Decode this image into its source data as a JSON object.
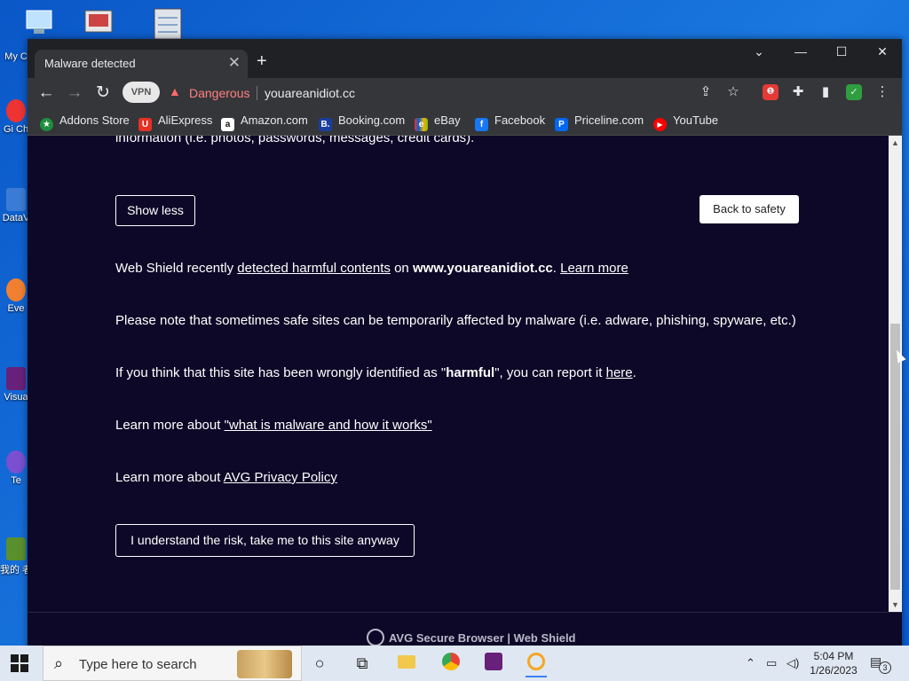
{
  "desktop": {
    "icons": [
      {
        "label": "My C"
      },
      {
        "label": "Gi Ch"
      },
      {
        "label": "DataV"
      },
      {
        "label": "Eve"
      },
      {
        "label": "Visua"
      },
      {
        "label": "Te"
      },
      {
        "label": "我的 者"
      }
    ]
  },
  "browser": {
    "tab_title": "Malware detected",
    "tab_close": "✕",
    "new_tab": "+",
    "window_controls": {
      "dropdown": "⌄",
      "minimize": "—",
      "maximize": "☐",
      "close": "✕"
    }
  },
  "toolbar": {
    "back": "←",
    "forward": "→",
    "reload": "↻",
    "vpn_label": "VPN",
    "security_label": "Dangerous",
    "url": "youareanidiot.cc"
  },
  "bookmarks": [
    {
      "label": "Addons Store",
      "color": "#1e8e3e",
      "glyph": "★"
    },
    {
      "label": "AliExpress",
      "color": "#e43225",
      "glyph": "U"
    },
    {
      "label": "Amazon.com",
      "color": "#ffffff",
      "glyph": "a"
    },
    {
      "label": "Booking.com",
      "color": "#1a3e9e",
      "glyph": "B."
    },
    {
      "label": "eBay",
      "color": "#35363a",
      "glyph": "e"
    },
    {
      "label": "Facebook",
      "color": "#1877f2",
      "glyph": "f"
    },
    {
      "label": "Priceline.com",
      "color": "#0068ef",
      "glyph": "P"
    },
    {
      "label": "YouTube",
      "color": "#ff0000",
      "glyph": "▶"
    }
  ],
  "page": {
    "partial_text": "information (i.e. photos, passwords, messages, credit cards).",
    "show_less": "Show less",
    "back_to_safety": "Back to safety",
    "p1": {
      "prefix": "Web Shield recently ",
      "link": "detected harmful contents",
      "mid": " on ",
      "domain": "www.youareanidiot.cc",
      "dot": ". ",
      "learn_more": "Learn more"
    },
    "p2": "Please note that sometimes safe sites can be temporarily affected by malware (i.e. adware, phishing, spyware, etc.)",
    "p3": {
      "prefix": "If you think that this site has been wrongly identified as \"",
      "bold": "harmful",
      "mid": "\", you can report it ",
      "link": "here",
      "suffix": "."
    },
    "p4": {
      "prefix": "Learn more about ",
      "link": "\"what is malware and how it works\""
    },
    "p5": {
      "prefix": "Learn more about ",
      "link": "AVG Privacy Policy"
    },
    "proceed_button": "I understand the risk, take me to this site anyway",
    "footer": "AVG Secure Browser | Web Shield"
  },
  "taskbar": {
    "search_placeholder": "Type here to search",
    "time": "5:04 PM",
    "date": "1/26/2023",
    "notification_count": "3"
  }
}
